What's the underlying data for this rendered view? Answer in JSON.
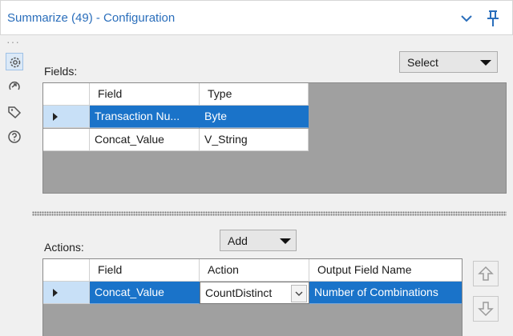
{
  "title": "Summarize (49) - Configuration",
  "colors": {
    "accent": "#2a6ebb",
    "selection": "#1a73c9",
    "grid_bg": "#a0a0a0"
  },
  "icons": {
    "title": [
      "chevron-down-icon",
      "pin-icon"
    ],
    "sidebar": [
      "settings-gear-icon",
      "tool-arrow-icon",
      "tag-icon",
      "help-icon"
    ]
  },
  "fields_section": {
    "label": "Fields:",
    "select_dropdown": "Select",
    "headers": [
      "Field",
      "Type"
    ],
    "rows": [
      {
        "field": "Transaction Nu...",
        "type": "Byte",
        "selected": true
      },
      {
        "field": "Concat_Value",
        "type": "V_String",
        "selected": false
      }
    ]
  },
  "actions_section": {
    "label": "Actions:",
    "add_dropdown": "Add",
    "headers": [
      "Field",
      "Action",
      "Output Field Name"
    ],
    "rows": [
      {
        "field": "Concat_Value",
        "action": "CountDistinct",
        "output": "Number of Combinations"
      }
    ],
    "move_buttons": [
      "move-up-icon",
      "move-down-icon"
    ]
  }
}
